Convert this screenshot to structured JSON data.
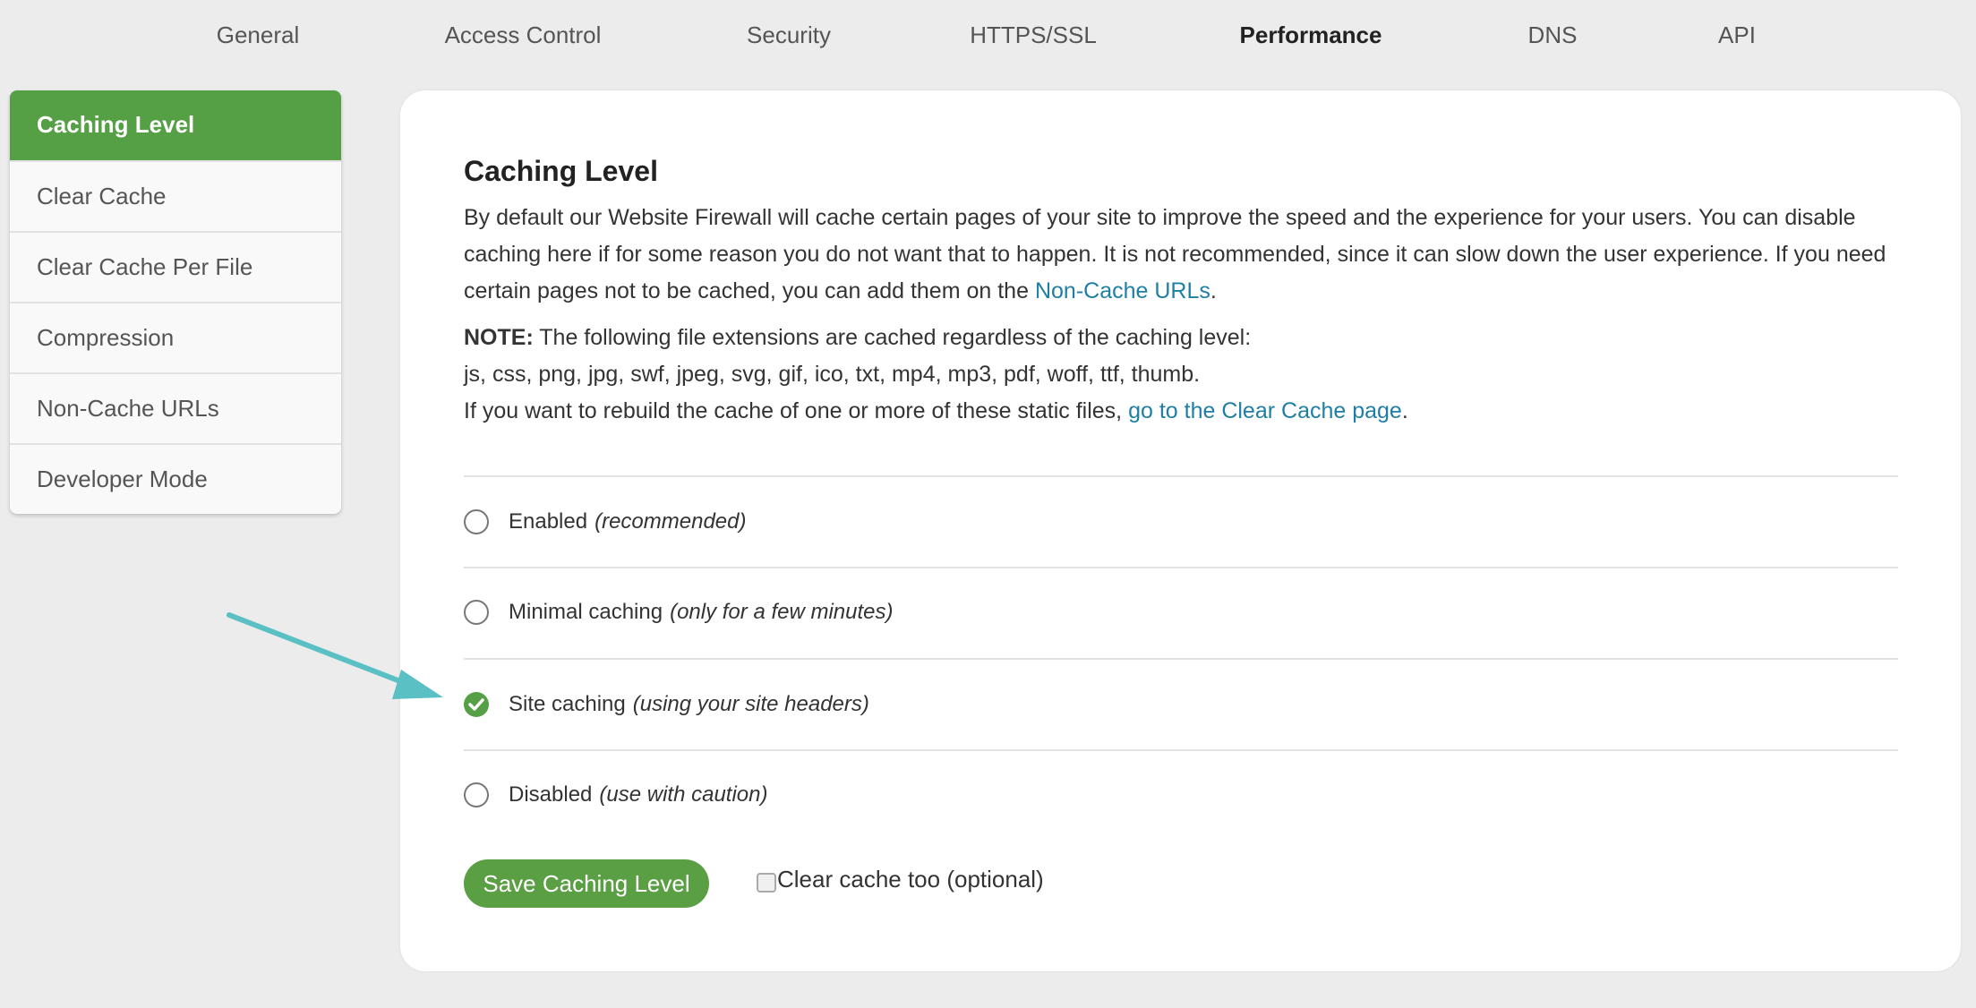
{
  "tabs": [
    {
      "label": "General",
      "active": false
    },
    {
      "label": "Access Control",
      "active": false
    },
    {
      "label": "Security",
      "active": false
    },
    {
      "label": "HTTPS/SSL",
      "active": false
    },
    {
      "label": "Performance",
      "active": true
    },
    {
      "label": "DNS",
      "active": false
    },
    {
      "label": "API",
      "active": false
    }
  ],
  "sidebar": {
    "items": [
      {
        "label": "Caching Level"
      },
      {
        "label": "Clear Cache"
      },
      {
        "label": "Clear Cache Per File"
      },
      {
        "label": "Compression"
      },
      {
        "label": "Non-Cache URLs"
      },
      {
        "label": "Developer Mode"
      }
    ]
  },
  "main": {
    "title": "Caching Level",
    "description": "By default our Website Firewall will cache certain pages of your site to improve the speed and the experience for your users. You can disable caching here if for some reason you do not want that to happen. It is not recommended, since it can slow down the user experience. If you need certain pages not to be cached, you can add them on the ",
    "description_link": "Non-Cache URLs",
    "note_label": "NOTE:",
    "note_text": " The following file extensions are cached regardless of the caching level:",
    "extensions": "js, css, png, jpg, swf, jpeg, svg, gif, ico, txt, mp4, mp3, pdf, woff, ttf, thumb.",
    "rebuild_text": "If you want to rebuild the cache of one or more of these static files, ",
    "rebuild_link": "go to the Clear Cache page",
    "options": [
      {
        "label": "Enabled",
        "hint": "(recommended)",
        "selected": false
      },
      {
        "label": "Minimal caching",
        "hint": "(only for a few minutes)",
        "selected": false
      },
      {
        "label": "Site caching",
        "hint": "(using your site headers)",
        "selected": true
      },
      {
        "label": "Disabled",
        "hint": "(use with caution)",
        "selected": false
      }
    ],
    "save_label": "Save Caching Level",
    "clear_cache_label": "Clear cache too (optional)",
    "clear_cache_checked": false
  },
  "colors": {
    "accent": "#559f44",
    "link": "#1e7fa6",
    "arrow": "#5bc0c4"
  }
}
